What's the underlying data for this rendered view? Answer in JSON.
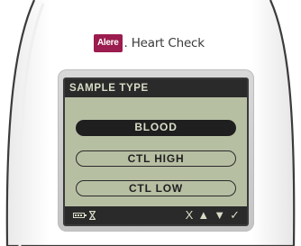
{
  "brand": {
    "logo_text": "Alere",
    "product_name": ". Heart Check",
    "logo_color": "#9b1c4e"
  },
  "screen": {
    "header": "SAMPLE TYPE",
    "options": [
      {
        "label": "BLOOD",
        "selected": true
      },
      {
        "label": "CTL HIGH",
        "selected": false
      },
      {
        "label": "CTL LOW",
        "selected": false
      }
    ],
    "status": {
      "battery_icon": "battery-icon",
      "hourglass_icon": "hourglass-icon"
    },
    "soft_keys": {
      "cancel": "X",
      "up": "▲",
      "down": "▼",
      "confirm": "✓"
    },
    "colors": {
      "lcd_background": "#b7bfa3",
      "lcd_dark": "#2a2a2a"
    }
  }
}
